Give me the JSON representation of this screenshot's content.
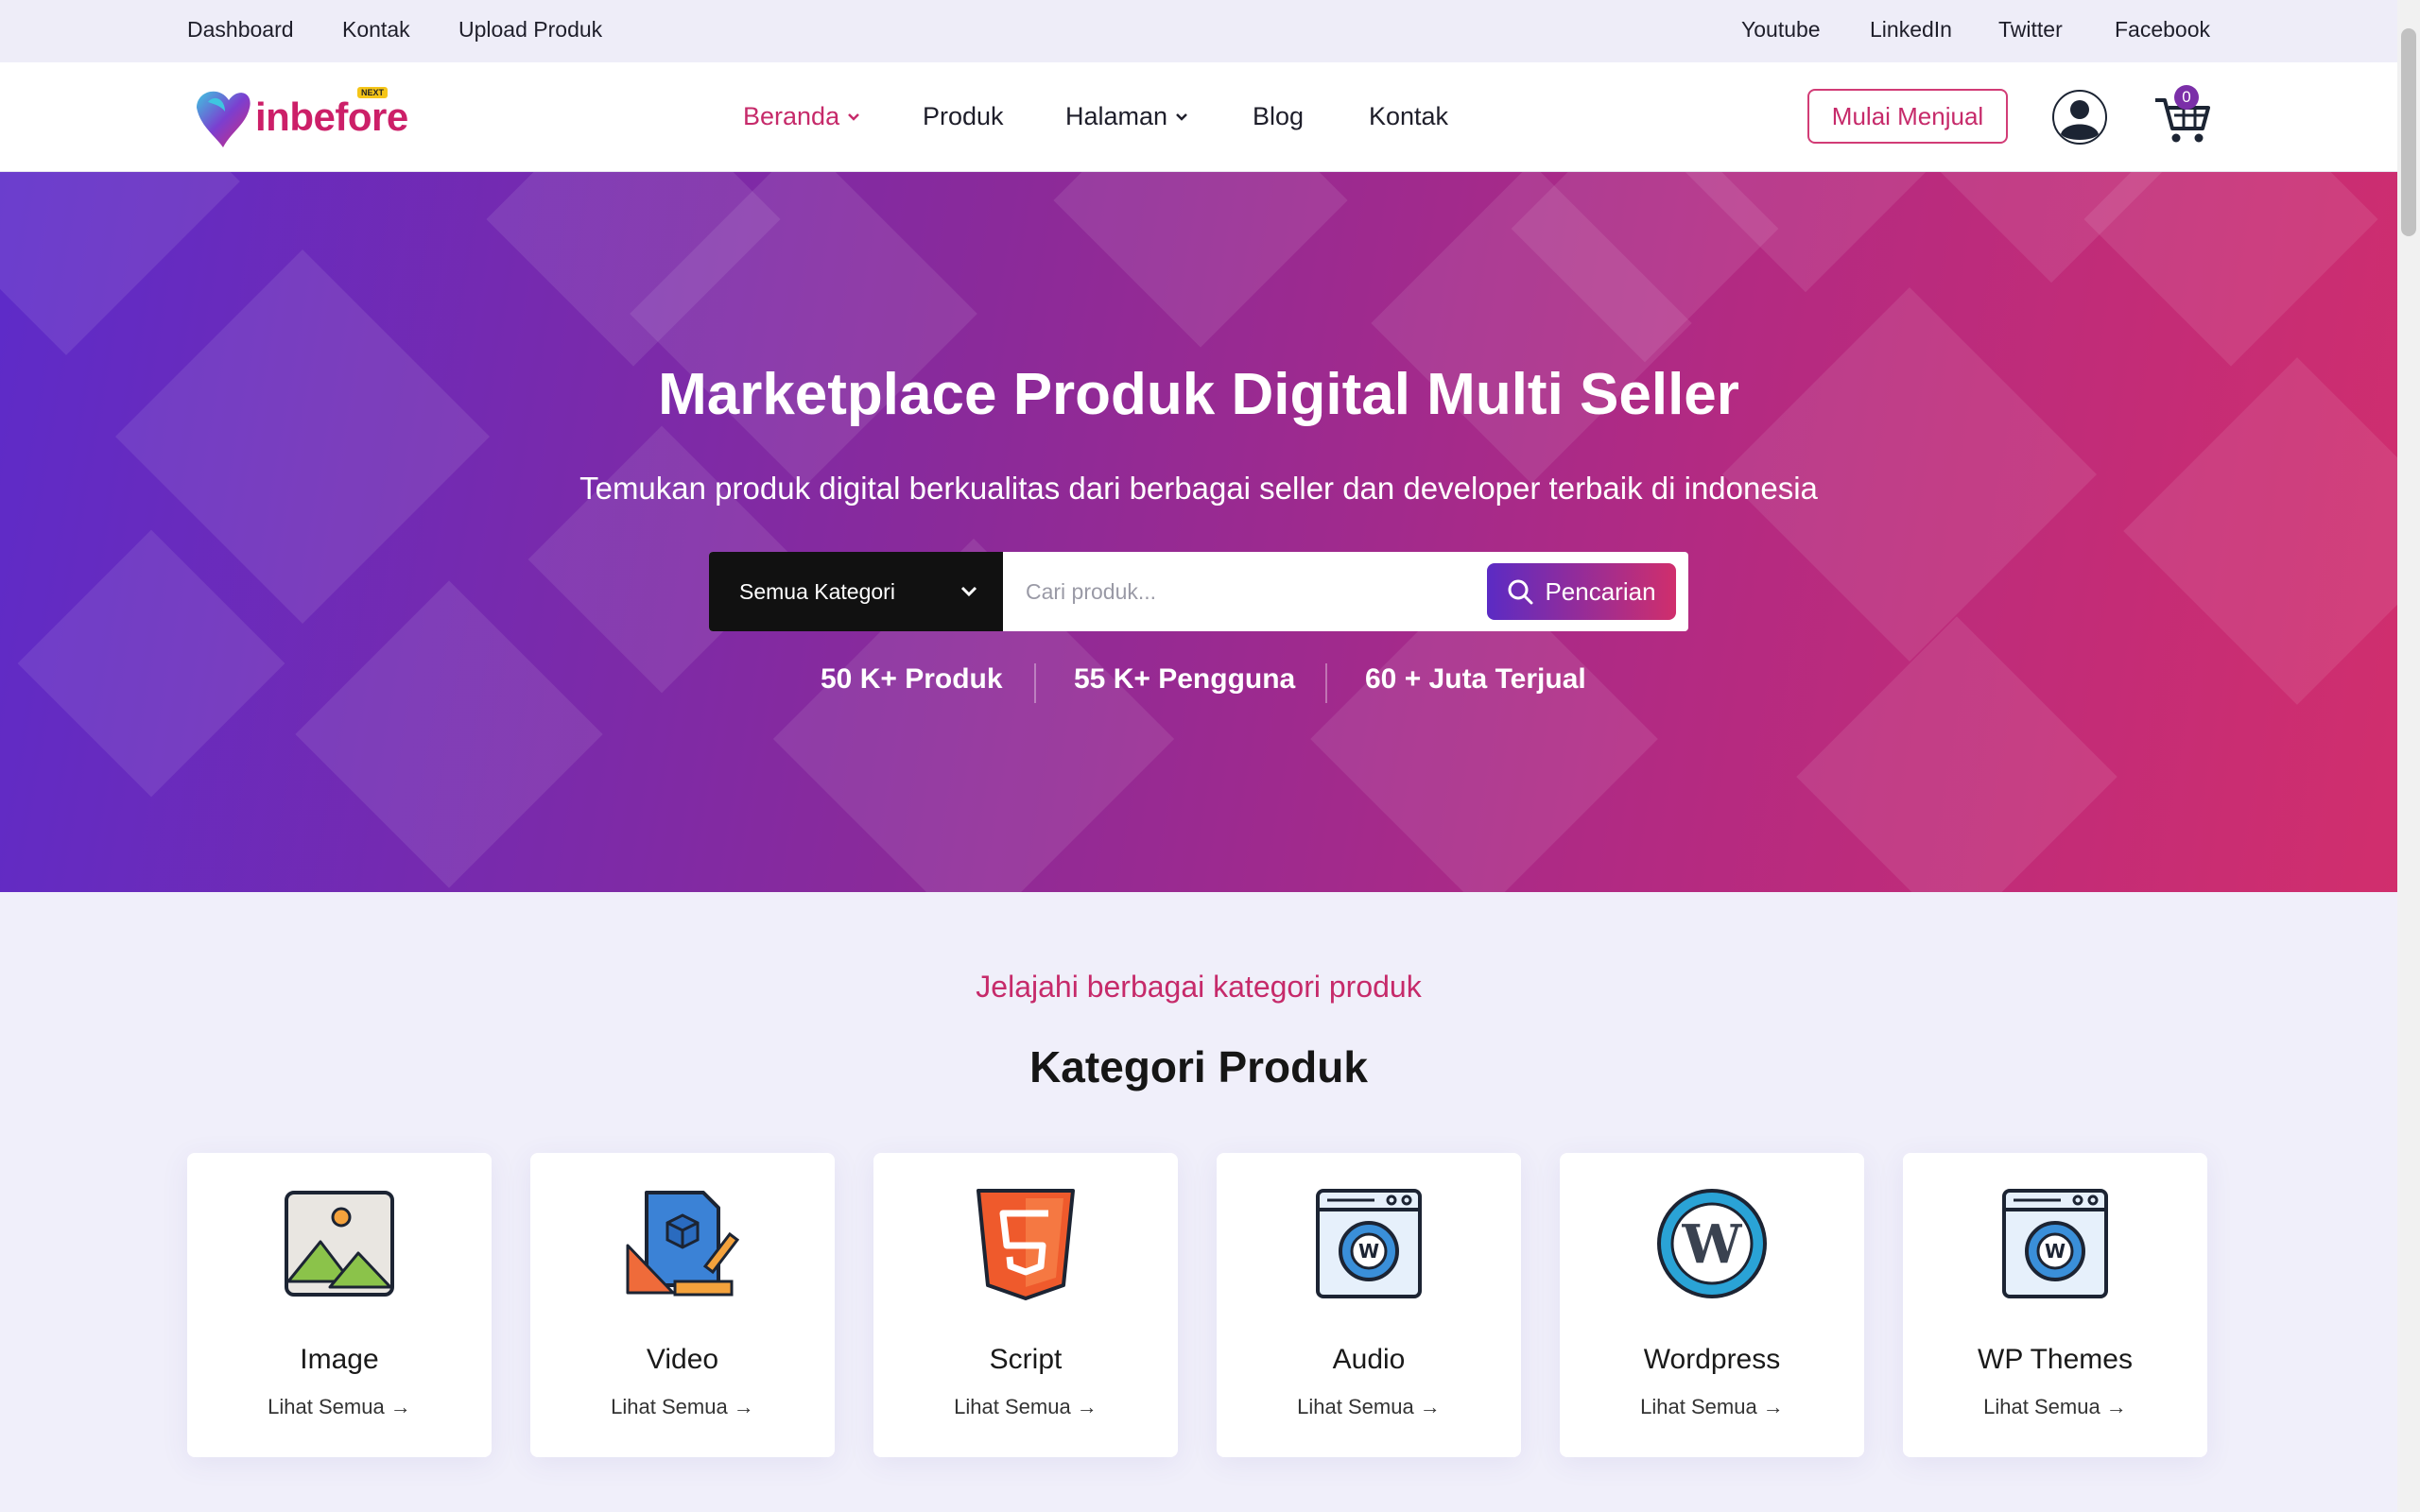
{
  "topbar": {
    "left_links": [
      "Dashboard",
      "Kontak",
      "Upload Produk"
    ],
    "right_links": [
      "Youtube",
      "LinkedIn",
      "Twitter",
      "Facebook"
    ]
  },
  "nav": {
    "logo_text": "inbefore",
    "logo_badge": "NEXT",
    "items": [
      "Beranda",
      "Produk",
      "Halaman",
      "Blog",
      "Kontak"
    ],
    "sell_button": "Mulai Menjual",
    "cart_count": "0"
  },
  "hero": {
    "title": "Marketplace Produk Digital Multi Seller",
    "subtitle": "Temukan produk digital berkualitas dari berbagai seller dan developer terbaik di indonesia",
    "category_select": "Semua Kategori",
    "search_placeholder": "Cari produk...",
    "search_button": "Pencarian",
    "stats": [
      "50 K+ Produk",
      "55 K+ Pengguna",
      "60 + Juta Terjual"
    ]
  },
  "categories": {
    "eyebrow": "Jelajahi berbagai kategori produk",
    "heading": "Kategori Produk",
    "items": [
      {
        "name": "Image",
        "link": "Lihat Semua →",
        "icon": "image-icon"
      },
      {
        "name": "Video",
        "link": "Lihat Semua →",
        "icon": "design-tools-icon"
      },
      {
        "name": "Script",
        "link": "Lihat Semua →",
        "icon": "html5-icon"
      },
      {
        "name": "Audio",
        "link": "Lihat Semua →",
        "icon": "wordpress-window-icon"
      },
      {
        "name": "Wordpress",
        "link": "Lihat Semua →",
        "icon": "wordpress-logo-icon"
      },
      {
        "name": "WP Themes",
        "link": "Lihat Semua →",
        "icon": "wordpress-window-icon"
      }
    ]
  },
  "colors": {
    "accent": "#c62a6a",
    "hero_start": "#5d2bc9",
    "hero_end": "#d12e6d"
  }
}
